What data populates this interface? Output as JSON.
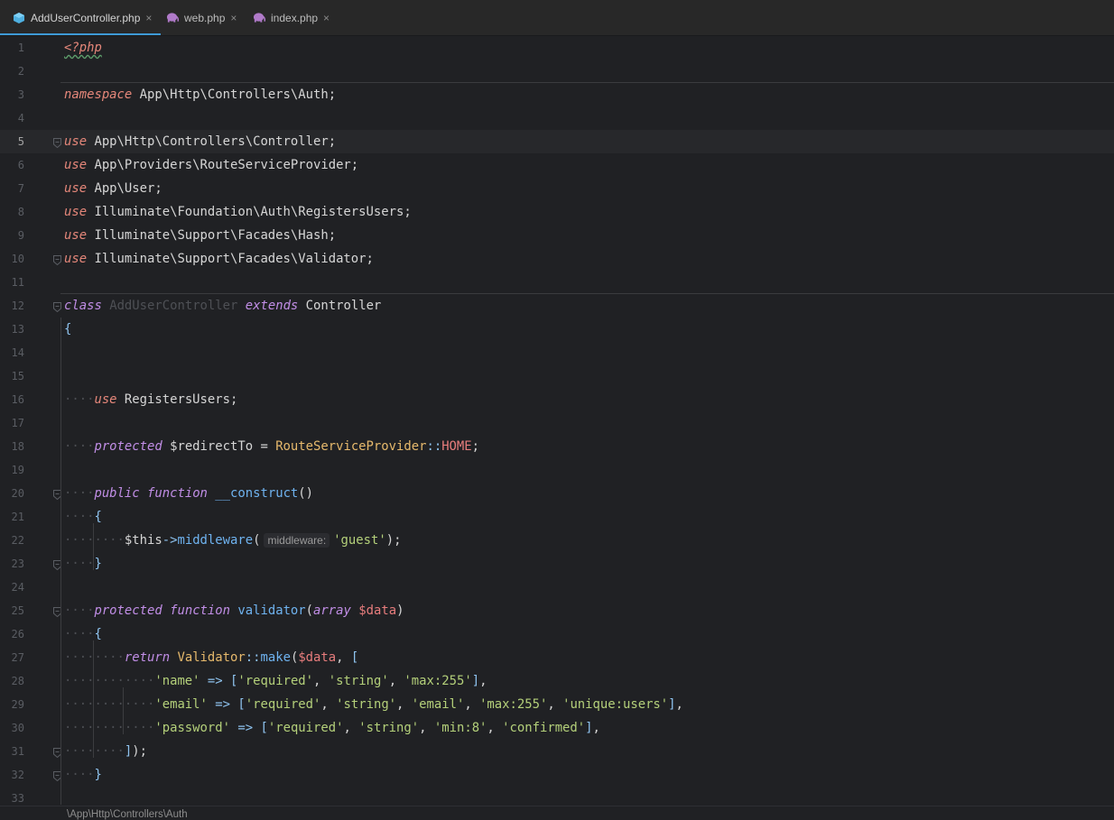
{
  "tabs": [
    {
      "label": "AddUserController.php",
      "icon": "php-class-icon",
      "active": true
    },
    {
      "label": "web.php",
      "icon": "php-elephant-icon",
      "active": false
    },
    {
      "label": "index.php",
      "icon": "php-elephant-icon",
      "active": false
    }
  ],
  "close_glyph": "×",
  "editor": {
    "current_line": 5,
    "line_numbers": [
      "1",
      "2",
      "3",
      "4",
      "5",
      "6",
      "7",
      "8",
      "9",
      "10",
      "11",
      "12",
      "13",
      "14",
      "15",
      "16",
      "17",
      "18",
      "19",
      "20",
      "21",
      "22",
      "23",
      "24",
      "25",
      "26",
      "27",
      "28",
      "29",
      "30",
      "31",
      "32",
      "33"
    ],
    "param_hint": "middleware:"
  },
  "breadcrumb": "\\App\\Http\\Controllers\\Auth",
  "colors": {
    "keyword": "#e5877a",
    "keyword_modifier": "#c18ee6",
    "function": "#6fb3f0",
    "string": "#b4d07a",
    "variable": "#e87d7d",
    "class_ref": "#e6b96c",
    "tab_underline": "#3e9ad6",
    "background": "#202124"
  }
}
